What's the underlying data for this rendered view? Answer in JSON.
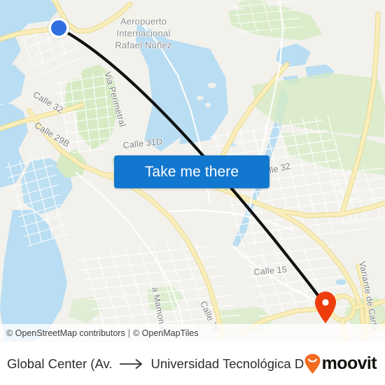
{
  "map": {
    "provider_attribution": {
      "osm": "© OpenStreetMap contributors",
      "separator": "|",
      "tiles": "© OpenMapTiles"
    },
    "colors": {
      "background": "#f2f1ec",
      "water": "#b9ddf2",
      "park": "#d6ebc4",
      "road_major": "#f7e9b0",
      "road_minor": "#ffffff",
      "route_line": "#000000",
      "origin_marker": "#2f6fe0",
      "destination_marker": "#ee3d0c",
      "cta_button": "#1277cf",
      "brand_orange": "#f26b21"
    },
    "place_labels": [
      {
        "id": "airport",
        "lines": [
          "Aeropuerto",
          "Internacional",
          "Rafael Núñez"
        ]
      }
    ],
    "street_labels": [
      {
        "id": "calle-32-left",
        "text": "Calle 32"
      },
      {
        "id": "calle-29b",
        "text": "Calle 29B"
      },
      {
        "id": "via-perimetral",
        "text": "Via Perimetral"
      },
      {
        "id": "calle-31d",
        "text": "Calle 31D"
      },
      {
        "id": "calle-32-right",
        "text": "lle 32"
      },
      {
        "id": "calle-15",
        "text": "Calle 15"
      },
      {
        "id": "via-mamonal",
        "text": "a Mamonal"
      },
      {
        "id": "calle-70",
        "text": "Calle 70"
      },
      {
        "id": "variante-de-cartagena",
        "text": "Variante de Carta"
      }
    ],
    "markers": {
      "origin": {
        "type": "dot",
        "name": "origin-marker"
      },
      "destination": {
        "type": "pin",
        "name": "destination-marker"
      }
    }
  },
  "cta": {
    "label": "Take me there"
  },
  "bottom_bar": {
    "origin_name": "Global Center (Av. ...",
    "arrow": "→",
    "destination_name": "Universidad Tecnológica De ...",
    "brand": {
      "name": "moovit",
      "icon": "moovit-pin-smile-icon"
    }
  }
}
